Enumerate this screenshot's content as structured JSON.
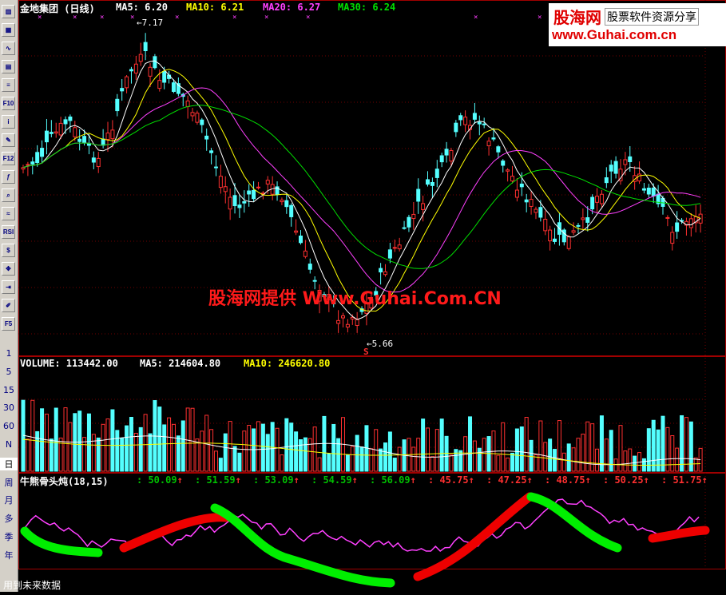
{
  "sidebar": {
    "tools": [
      "chart-icon",
      "table-icon",
      "line-icon",
      "multi-chart-icon",
      "depth-icon",
      "F10",
      "info-icon",
      "notes-icon",
      "F12",
      "formula-icon",
      "zoom-icon",
      "wave-icon",
      "RSI",
      "dollar-icon",
      "move-icon",
      "exit-icon",
      "pen-icon",
      "F5"
    ],
    "periods": [
      "1",
      "5",
      "15",
      "30",
      "60",
      "N",
      "日",
      "周",
      "月",
      "多",
      "季",
      "年"
    ]
  },
  "price_panel": {
    "title": "金地集团 (日线)",
    "ma5": "MA5: 6.20",
    "ma10": "MA10: 6.21",
    "ma20": "MA20: 6.27",
    "ma30": "MA30: 6.24",
    "high_label": "7.17",
    "low_label": "5.66",
    "low_marker": "S",
    "colors": {
      "up": "#ff3030",
      "down": "#54ffff",
      "ma5": "#ffffff",
      "ma10": "#ffff00",
      "ma20": "#ff40ff",
      "ma30": "#00e000"
    }
  },
  "volume_panel": {
    "label": "VOLUME: 113442.00",
    "ma5": "MA5: 214604.80",
    "ma10": "MA10: 246620.80"
  },
  "indicator_panel": {
    "title": "牛熊骨头炖(18,15)",
    "levels": [
      {
        "text": ": 50.09",
        "color": "#00c000"
      },
      {
        "text": ": 51.59",
        "color": "#00c000"
      },
      {
        "text": ": 53.09",
        "color": "#00c000"
      },
      {
        "text": ": 54.59",
        "color": "#00c000"
      },
      {
        "text": ": 56.09",
        "color": "#00c000"
      },
      {
        "text": ": 45.75",
        "color": "#ff3030"
      },
      {
        "text": ": 47.25",
        "color": "#ff3030"
      },
      {
        "text": ": 48.75",
        "color": "#ff3030"
      },
      {
        "text": ": 50.25",
        "color": "#ff3030"
      },
      {
        "text": ": 51.75",
        "color": "#ff3030"
      }
    ]
  },
  "brand": {
    "logo": "股海网",
    "slogan": "股票软件资源分享",
    "url": "www.Guhai.com.cn"
  },
  "watermark": "股海网提供 Www.Guhai.Com.CN",
  "footer": "用到未来数据"
}
